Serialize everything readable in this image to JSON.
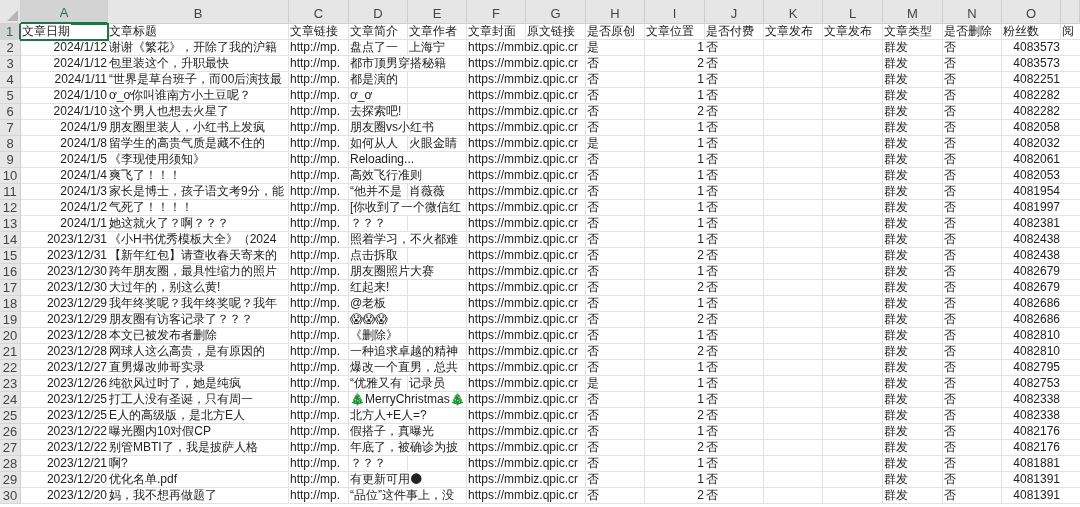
{
  "columns": [
    {
      "letter": "A",
      "header": "文章日期",
      "selected": true
    },
    {
      "letter": "B",
      "header": "文章标题",
      "selected": false
    },
    {
      "letter": "C",
      "header": "文章链接",
      "selected": false
    },
    {
      "letter": "D",
      "header": "文章简介",
      "selected": false
    },
    {
      "letter": "E",
      "header": "文章作者",
      "selected": false
    },
    {
      "letter": "F",
      "header": "文章封面",
      "selected": false
    },
    {
      "letter": "G",
      "header": "原文链接",
      "selected": false
    },
    {
      "letter": "H",
      "header": "是否原创",
      "selected": false
    },
    {
      "letter": "I",
      "header": "文章位置",
      "selected": false
    },
    {
      "letter": "J",
      "header": "是否付费",
      "selected": false
    },
    {
      "letter": "K",
      "header": "文章发布",
      "selected": false
    },
    {
      "letter": "L",
      "header": "文章发布",
      "selected": false
    },
    {
      "letter": "M",
      "header": "文章类型",
      "selected": false
    },
    {
      "letter": "N",
      "header": "是否删除",
      "selected": false
    },
    {
      "letter": "O",
      "header": "粉丝数",
      "selected": false
    },
    {
      "header": "阅",
      "selected": false
    }
  ],
  "rows": [
    {
      "number": "2",
      "selected": false,
      "A": "2024/1/12",
      "B": "谢谢《繁花》，开除了我的沪籍",
      "C": "http://mp.",
      "D": "盘点了一",
      "E": "上海宁",
      "F": "https://mmbiz.qpic.cr",
      "H": "是",
      "I": "1",
      "J": "否",
      "M": "群发",
      "N": "否",
      "O": "4083573"
    },
    {
      "number": "3",
      "selected": false,
      "A": "2024/1/12",
      "B": "包里装这个，升职最快",
      "C": "http://mp.",
      "D": "都市顶男穿搭秘籍",
      "F": "https://mmbiz.qpic.cr",
      "H": "否",
      "I": "2",
      "J": "否",
      "M": "群发",
      "N": "否",
      "O": "4083573"
    },
    {
      "number": "4",
      "selected": false,
      "A": "2024/1/11",
      "B": "“世界是草台班子，而00后演技最",
      "C": "http://mp.",
      "D": "都是演的",
      "F": "https://mmbiz.qpic.cr",
      "H": "否",
      "I": "1",
      "J": "否",
      "M": "群发",
      "N": "否",
      "O": "4082251"
    },
    {
      "number": "5",
      "selected": false,
      "A": "2024/1/10",
      "B": "ơ_ơ你叫谁南方小土豆呢？",
      "C": "http://mp.",
      "D": "ơ_ơ",
      "F": "https://mmbiz.qpic.cr",
      "H": "否",
      "I": "1",
      "J": "否",
      "M": "群发",
      "N": "否",
      "O": "4082282"
    },
    {
      "number": "6",
      "selected": false,
      "A": "2024/1/10",
      "B": "这个男人也想去火星了",
      "C": "http://mp.",
      "D": "去探索吧!",
      "F": "https://mmbiz.qpic.cr",
      "H": "否",
      "I": "2",
      "J": "否",
      "M": "群发",
      "N": "否",
      "O": "4082282"
    },
    {
      "number": "7",
      "selected": false,
      "A": "2024/1/9",
      "B": "朋友圈里装人，小红书上发疯",
      "C": "http://mp.",
      "D": "朋友圈vs小红书",
      "F": "https://mmbiz.qpic.cr",
      "H": "否",
      "I": "1",
      "J": "否",
      "M": "群发",
      "N": "否",
      "O": "4082058"
    },
    {
      "number": "8",
      "selected": false,
      "A": "2024/1/8",
      "B": "留学生的高贵气质是藏不住的",
      "C": "http://mp.",
      "D": "如何从人",
      "E": "火眼金睛",
      "F": "https://mmbiz.qpic.cr",
      "H": "是",
      "I": "1",
      "J": "否",
      "M": "群发",
      "N": "否",
      "O": "4082032"
    },
    {
      "number": "9",
      "selected": false,
      "A": "2024/1/5",
      "B": "《李现使用须知》",
      "C": "http://mp.",
      "D": "Reloading...",
      "F": "https://mmbiz.qpic.cr",
      "H": "否",
      "I": "1",
      "J": "否",
      "M": "群发",
      "N": "否",
      "O": "4082061"
    },
    {
      "number": "10",
      "selected": false,
      "A": "2024/1/4",
      "B": "爽飞了！！！",
      "C": "http://mp.",
      "D": "高效飞行准则",
      "F": "https://mmbiz.qpic.cr",
      "H": "否",
      "I": "1",
      "J": "否",
      "M": "群发",
      "N": "否",
      "O": "4082053"
    },
    {
      "number": "11",
      "selected": false,
      "A": "2024/1/3",
      "B": "家长是博士，孩子语文考9分，能",
      "C": "http://mp.",
      "D": "“他并不是",
      "E": "肖薇薇",
      "F": "https://mmbiz.qpic.cr",
      "H": "否",
      "I": "1",
      "J": "否",
      "M": "群发",
      "N": "否",
      "O": "4081954"
    },
    {
      "number": "12",
      "selected": false,
      "A": "2024/1/2",
      "B": "气死了！！！！",
      "C": "http://mp.",
      "D": "[你收到了一个微信红",
      "F": "https://mmbiz.qpic.cr",
      "H": "否",
      "I": "1",
      "J": "否",
      "M": "群发",
      "N": "否",
      "O": "4081997"
    },
    {
      "number": "13",
      "selected": false,
      "A": "2024/1/1",
      "B": "她这就火了？啊？？？",
      "C": "http://mp.",
      "D": "？？？",
      "F": "https://mmbiz.qpic.cr",
      "H": "否",
      "I": "1",
      "J": "否",
      "M": "群发",
      "N": "否",
      "O": "4082381"
    },
    {
      "number": "14",
      "selected": false,
      "A": "2023/12/31",
      "B": "《小H书优秀模板大全》（2024",
      "C": "http://mp.",
      "D": "照着学习，不火都难",
      "F": "https://mmbiz.qpic.cr",
      "H": "否",
      "I": "1",
      "J": "否",
      "M": "群发",
      "N": "否",
      "O": "4082438"
    },
    {
      "number": "15",
      "selected": false,
      "A": "2023/12/31",
      "B": "【新年红包】请查收春天寄来的",
      "C": "http://mp.",
      "D": "点击拆取",
      "F": "https://mmbiz.qpic.cr",
      "H": "否",
      "I": "2",
      "J": "否",
      "M": "群发",
      "N": "否",
      "O": "4082438"
    },
    {
      "number": "16",
      "selected": false,
      "A": "2023/12/30",
      "B": "跨年朋友圈，最具性缩力的照片",
      "C": "http://mp.",
      "D": "朋友圈照片大赛",
      "F": "https://mmbiz.qpic.cr",
      "H": "否",
      "I": "1",
      "J": "否",
      "M": "群发",
      "N": "否",
      "O": "4082679"
    },
    {
      "number": "17",
      "selected": false,
      "A": "2023/12/30",
      "B": "大过年的，别这么黄!",
      "C": "http://mp.",
      "D": "红起来!",
      "F": "https://mmbiz.qpic.cr",
      "H": "否",
      "I": "2",
      "J": "否",
      "M": "群发",
      "N": "否",
      "O": "4082679"
    },
    {
      "number": "18",
      "selected": false,
      "A": "2023/12/29",
      "B": "我年终奖呢？我年终奖呢？我年",
      "C": "http://mp.",
      "D": "@老板",
      "F": "https://mmbiz.qpic.cr",
      "H": "否",
      "I": "1",
      "J": "否",
      "M": "群发",
      "N": "否",
      "O": "4082686"
    },
    {
      "number": "19",
      "selected": false,
      "A": "2023/12/29",
      "B": "朋友圈有访客记录了？？？",
      "C": "http://mp.",
      "D": "😱😱😱",
      "F": "https://mmbiz.qpic.cr",
      "H": "否",
      "I": "2",
      "J": "否",
      "M": "群发",
      "N": "否",
      "O": "4082686"
    },
    {
      "number": "20",
      "selected": false,
      "A": "2023/12/28",
      "B": "本文已被发布者删除",
      "C": "http://mp.",
      "D": "《删除》",
      "F": "https://mmbiz.qpic.cr",
      "H": "否",
      "I": "1",
      "J": "否",
      "M": "群发",
      "N": "否",
      "O": "4082810"
    },
    {
      "number": "21",
      "selected": false,
      "A": "2023/12/28",
      "B": "网球人这么高贵，是有原因的",
      "C": "http://mp.",
      "D": "一种追求卓越的精神",
      "F": "https://mmbiz.qpic.cr",
      "H": "否",
      "I": "2",
      "J": "否",
      "M": "群发",
      "N": "否",
      "O": "4082810"
    },
    {
      "number": "22",
      "selected": false,
      "A": "2023/12/27",
      "B": "直男爆改帅哥实录",
      "C": "http://mp.",
      "D": "爆改一个直男，总共",
      "F": "https://mmbiz.qpic.cr",
      "H": "否",
      "I": "1",
      "J": "否",
      "M": "群发",
      "N": "否",
      "O": "4082795"
    },
    {
      "number": "23",
      "selected": false,
      "A": "2023/12/26",
      "B": "纯欲风过时了，她是纯疯",
      "C": "http://mp.",
      "D": "“优雅又有",
      "E": "记录员",
      "F": "https://mmbiz.qpic.cr",
      "H": "是",
      "I": "1",
      "J": "否",
      "M": "群发",
      "N": "否",
      "O": "4082753"
    },
    {
      "number": "24",
      "selected": false,
      "A": "2023/12/25",
      "B": "打工人没有圣诞，只有周一",
      "C": "http://mp.",
      "D": "🎄MerryChristmas🎄",
      "F": "https://mmbiz.qpic.cr",
      "H": "否",
      "I": "1",
      "J": "否",
      "M": "群发",
      "N": "否",
      "O": "4082338"
    },
    {
      "number": "25",
      "selected": false,
      "A": "2023/12/25",
      "B": "E人的高级版，是北方E人",
      "C": "http://mp.",
      "D": "北方人+E人=?",
      "F": "https://mmbiz.qpic.cr",
      "H": "否",
      "I": "2",
      "J": "否",
      "M": "群发",
      "N": "否",
      "O": "4082338"
    },
    {
      "number": "26",
      "selected": false,
      "A": "2023/12/22",
      "B": "曝光圈内10对假CP",
      "C": "http://mp.",
      "D": "假搭子，真曝光",
      "F": "https://mmbiz.qpic.cr",
      "H": "否",
      "I": "1",
      "J": "否",
      "M": "群发",
      "N": "否",
      "O": "4082176"
    },
    {
      "number": "27",
      "selected": false,
      "A": "2023/12/22",
      "B": "别管MBTI了，我是披萨人格",
      "C": "http://mp.",
      "D": "年底了，被确诊为披",
      "F": "https://mmbiz.qpic.cr",
      "H": "否",
      "I": "2",
      "J": "否",
      "M": "群发",
      "N": "否",
      "O": "4082176"
    },
    {
      "number": "28",
      "selected": false,
      "A": "2023/12/21",
      "B": "啊?",
      "C": "http://mp.",
      "D": "？？？",
      "F": "https://mmbiz.qpic.cr",
      "H": "否",
      "I": "1",
      "J": "否",
      "M": "群发",
      "N": "否",
      "O": "4081881"
    },
    {
      "number": "29",
      "selected": false,
      "A": "2023/12/20",
      "B": "优化名单.pdf",
      "C": "http://mp.",
      "D": "有更新可用🌑",
      "F": "https://mmbiz.qpic.cr",
      "H": "否",
      "I": "1",
      "J": "否",
      "M": "群发",
      "N": "否",
      "O": "4081391"
    },
    {
      "number": "30",
      "selected": false,
      "A": "2023/12/20",
      "B": "妈，我不想再做题了",
      "C": "http://mp.",
      "D": "“品位”这件事上，没",
      "F": "https://mmbiz.qpic.cr",
      "H": "否",
      "I": "2",
      "J": "否",
      "M": "群发",
      "N": "否",
      "O": "4081391"
    }
  ],
  "header_row": {
    "number": "1",
    "selected": true
  }
}
